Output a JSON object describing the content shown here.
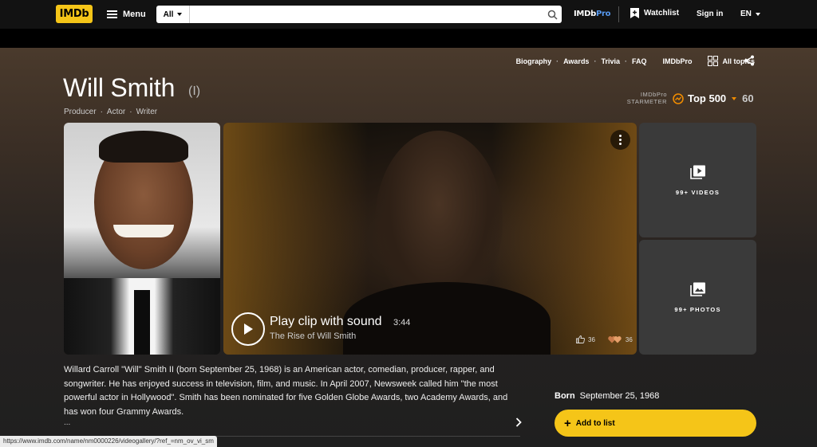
{
  "header": {
    "logo": "IMDb",
    "menu_label": "Menu",
    "search": {
      "category": "All",
      "placeholder": "",
      "value": ""
    },
    "imdbpro": {
      "a": "IMDb",
      "b": "Pro"
    },
    "watchlist_label": "Watchlist",
    "signin_label": "Sign in",
    "lang_label": "EN"
  },
  "subnav": {
    "items": [
      "Biography",
      "Awards",
      "Trivia",
      "FAQ"
    ],
    "imdbpro_label": "IMDbPro",
    "all_topics_label": "All topics"
  },
  "person": {
    "name": "Will Smith",
    "suffix": "(I)",
    "roles": [
      "Producer",
      "Actor",
      "Writer"
    ]
  },
  "starmeter": {
    "label_line1": "IMDbPro",
    "label_line2": "STARMETER",
    "rank": "Top 500",
    "change": "60"
  },
  "video": {
    "title": "Play clip with sound",
    "duration": "3:44",
    "subtitle": "The Rise of Will Smith",
    "likes": "36",
    "hearts": "36"
  },
  "tiles": {
    "videos_label": "99+ VIDEOS",
    "photos_label": "99+ PHOTOS"
  },
  "bio": {
    "text": "Willard Carroll \"Will\" Smith II (born September 25, 1968) is an American actor, comedian, producer, rapper, and songwriter. He has enjoyed success in television, film, and music. In April 2007, Newsweek called him \"the most powerful actor in Hollywood\". Smith has been nominated for five Golden Globe Awards, two Academy Awards, and has won four Grammy Awards.",
    "ellipsis": "..."
  },
  "born": {
    "label": "Born",
    "value": "September 25, 1968"
  },
  "add_to_list_label": "Add to list",
  "status_url": "https://www.imdb.com/name/nm0000226/videogallery/?ref_=nm_ov_vi_sm",
  "colors": {
    "brand": "#f5c518",
    "pro_blue": "#5799ef",
    "starmeter_orange": "#f08c00"
  }
}
